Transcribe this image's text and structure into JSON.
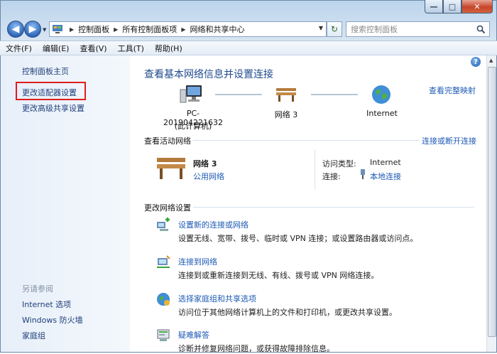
{
  "window": {
    "minimize": "—",
    "maximize": "□",
    "close": "✕"
  },
  "nav": {
    "breadcrumbs": [
      "控制面板",
      "所有控制面板项",
      "网络和共享中心"
    ],
    "search_placeholder": "搜索控制面板"
  },
  "menu": [
    "文件(F)",
    "编辑(E)",
    "查看(V)",
    "工具(T)",
    "帮助(H)"
  ],
  "sidebar": {
    "home": "控制面板主页",
    "adapter": "更改适配器设置",
    "advanced": "更改高级共享设置",
    "see_also_heading": "另请参阅",
    "see_also": [
      "Internet 选项",
      "Windows 防火墙",
      "家庭组"
    ]
  },
  "main": {
    "title": "查看基本网络信息并设置连接",
    "full_map": "查看完整映射",
    "map": {
      "computer_name": "PC-201904221632",
      "computer_sub": "(此计算机)",
      "network": "网络  3",
      "internet": "Internet"
    },
    "active": {
      "heading": "查看活动网络",
      "connect_link": "连接或断开连接",
      "network_name": "网络  3",
      "network_type": "公用网络",
      "access_label": "访问类型:",
      "access_value": "Internet",
      "conn_label": "连接:",
      "conn_value": "本地连接"
    },
    "change": {
      "heading": "更改网络设置",
      "tasks": [
        {
          "title": "设置新的连接或网络",
          "desc": "设置无线、宽带、拨号、临时或 VPN 连接；或设置路由器或访问点。"
        },
        {
          "title": "连接到网络",
          "desc": "连接到或重新连接到无线、有线、拨号或 VPN 网络连接。"
        },
        {
          "title": "选择家庭组和共享选项",
          "desc": "访问位于其他网络计算机上的文件和打印机，或更改共享设置。"
        },
        {
          "title": "疑难解答",
          "desc": "诊断并修复网络问题，或获得故障排除信息。"
        }
      ]
    }
  },
  "colors": {
    "link": "#1e5ab4",
    "title": "#1f4a8d",
    "highlight_box": "#e01d1d"
  }
}
